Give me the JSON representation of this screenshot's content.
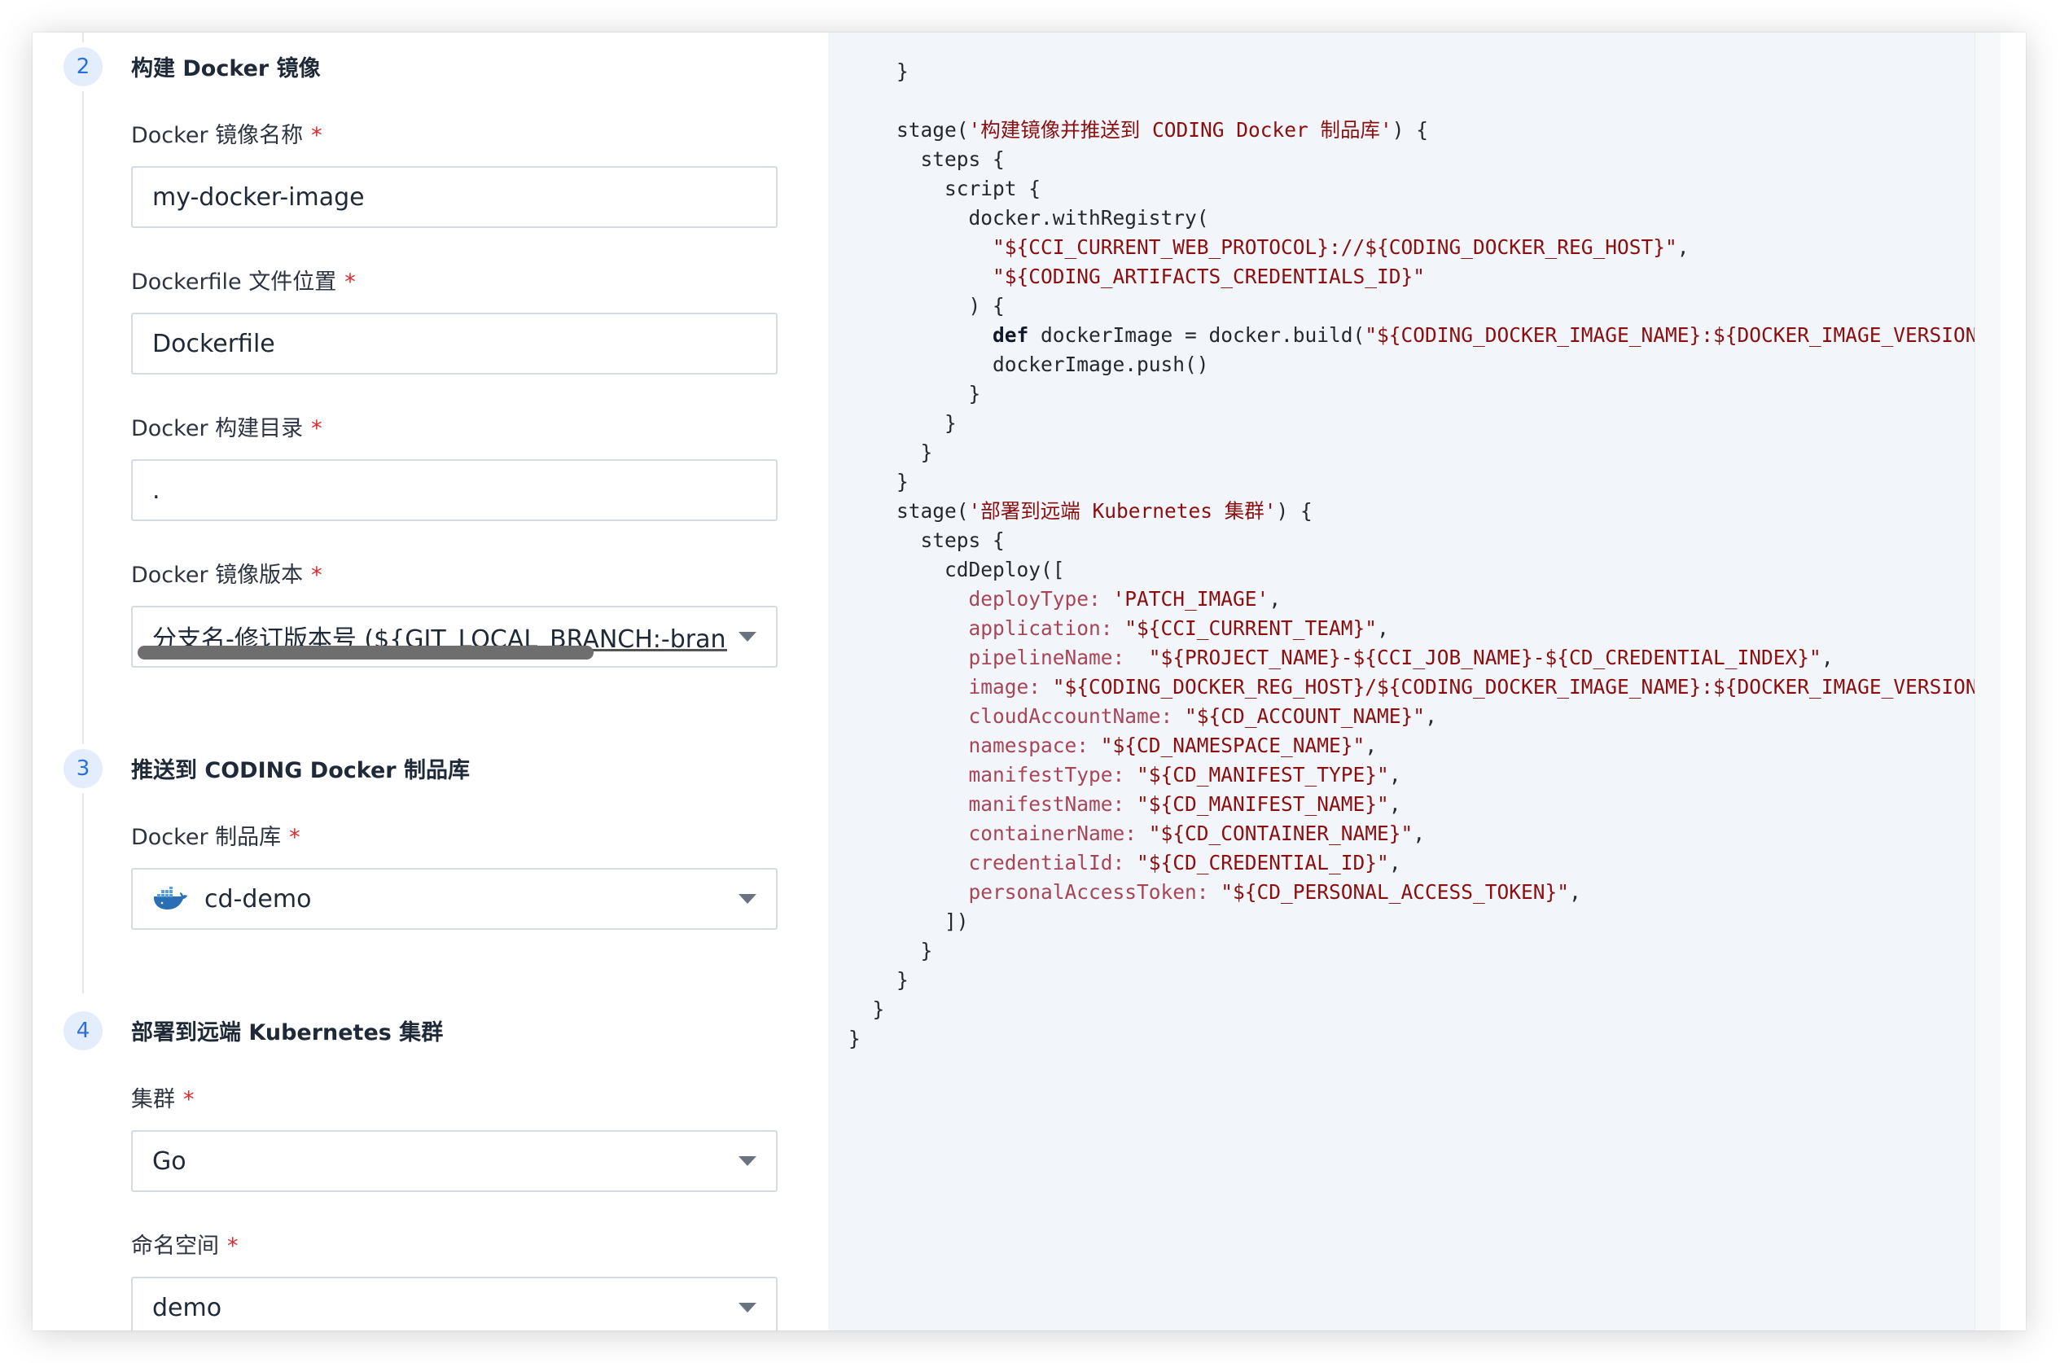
{
  "form": {
    "steps": [
      {
        "number": "2",
        "title": "构建 Docker 镜像",
        "fields": [
          {
            "label": "Docker 镜像名称",
            "required": "*",
            "type": "input",
            "value": "my-docker-image"
          },
          {
            "label": "Dockerfile 文件位置",
            "required": "*",
            "type": "input",
            "value": "Dockerfile"
          },
          {
            "label": "Docker 构建目录",
            "required": "*",
            "type": "input",
            "value": "."
          },
          {
            "label": "Docker 镜像版本",
            "required": "*",
            "type": "select",
            "value": "分支名-修订版本号 (${GIT_LOCAL_BRANCH:-branch}-$"
          }
        ]
      },
      {
        "number": "3",
        "title": "推送到 CODING Docker 制品库",
        "fields": [
          {
            "label": "Docker 制品库",
            "required": "*",
            "type": "select",
            "icon": "docker-whale-icon",
            "value": "cd-demo"
          }
        ]
      },
      {
        "number": "4",
        "title": "部署到远端 Kubernetes 集群",
        "fields": [
          {
            "label": "集群",
            "required": "*",
            "type": "select",
            "value": "Go"
          },
          {
            "label": "命名空间",
            "required": "*",
            "type": "select",
            "value": "demo"
          }
        ]
      }
    ]
  },
  "code": {
    "lines": [
      [
        [
          "p",
          "    }"
        ]
      ],
      [
        [
          "p",
          ""
        ]
      ],
      [
        [
          "p",
          "    stage("
        ],
        [
          "s",
          "'构建镜像并推送到 CODING Docker 制品库'"
        ],
        [
          "p",
          ") {"
        ]
      ],
      [
        [
          "p",
          "      steps {"
        ]
      ],
      [
        [
          "p",
          "        script {"
        ]
      ],
      [
        [
          "p",
          "          docker.withRegistry("
        ]
      ],
      [
        [
          "p",
          "            "
        ],
        [
          "s",
          "\"${CCI_CURRENT_WEB_PROTOCOL}://${CODING_DOCKER_REG_HOST}\""
        ],
        [
          "p",
          ","
        ]
      ],
      [
        [
          "p",
          "            "
        ],
        [
          "s",
          "\"${CODING_ARTIFACTS_CREDENTIALS_ID}\""
        ]
      ],
      [
        [
          "p",
          "          ) {"
        ]
      ],
      [
        [
          "p",
          "            "
        ],
        [
          "k",
          "def"
        ],
        [
          "p",
          " dockerImage = docker.build("
        ],
        [
          "s",
          "\"${CODING_DOCKER_IMAGE_NAME}:${DOCKER_IMAGE_VERSION}\""
        ],
        [
          "p",
          ","
        ]
      ],
      [
        [
          "p",
          "            dockerImage.push()"
        ]
      ],
      [
        [
          "p",
          "          }"
        ]
      ],
      [
        [
          "p",
          "        }"
        ]
      ],
      [
        [
          "p",
          "      }"
        ]
      ],
      [
        [
          "p",
          "    }"
        ]
      ],
      [
        [
          "p",
          "    stage("
        ],
        [
          "s",
          "'部署到远端 Kubernetes 集群'"
        ],
        [
          "p",
          ") {"
        ]
      ],
      [
        [
          "p",
          "      steps {"
        ]
      ],
      [
        [
          "p",
          "        cdDeploy(["
        ]
      ],
      [
        [
          "p",
          "          "
        ],
        [
          "a",
          "deployType:"
        ],
        [
          "p",
          " "
        ],
        [
          "s",
          "'PATCH_IMAGE'"
        ],
        [
          "p",
          ","
        ]
      ],
      [
        [
          "p",
          "          "
        ],
        [
          "a",
          "application:"
        ],
        [
          "p",
          " "
        ],
        [
          "s",
          "\"${CCI_CURRENT_TEAM}\""
        ],
        [
          "p",
          ","
        ]
      ],
      [
        [
          "p",
          "          "
        ],
        [
          "a",
          "pipelineName:"
        ],
        [
          "p",
          "  "
        ],
        [
          "s",
          "\"${PROJECT_NAME}-${CCI_JOB_NAME}-${CD_CREDENTIAL_INDEX}\""
        ],
        [
          "p",
          ","
        ]
      ],
      [
        [
          "p",
          "          "
        ],
        [
          "a",
          "image:"
        ],
        [
          "p",
          " "
        ],
        [
          "s",
          "\"${CODING_DOCKER_REG_HOST}/${CODING_DOCKER_IMAGE_NAME}:${DOCKER_IMAGE_VERSION}\""
        ],
        [
          "p",
          ","
        ]
      ],
      [
        [
          "p",
          "          "
        ],
        [
          "a",
          "cloudAccountName:"
        ],
        [
          "p",
          " "
        ],
        [
          "s",
          "\"${CD_ACCOUNT_NAME}\""
        ],
        [
          "p",
          ","
        ]
      ],
      [
        [
          "p",
          "          "
        ],
        [
          "a",
          "namespace:"
        ],
        [
          "p",
          " "
        ],
        [
          "s",
          "\"${CD_NAMESPACE_NAME}\""
        ],
        [
          "p",
          ","
        ]
      ],
      [
        [
          "p",
          "          "
        ],
        [
          "a",
          "manifestType:"
        ],
        [
          "p",
          " "
        ],
        [
          "s",
          "\"${CD_MANIFEST_TYPE}\""
        ],
        [
          "p",
          ","
        ]
      ],
      [
        [
          "p",
          "          "
        ],
        [
          "a",
          "manifestName:"
        ],
        [
          "p",
          " "
        ],
        [
          "s",
          "\"${CD_MANIFEST_NAME}\""
        ],
        [
          "p",
          ","
        ]
      ],
      [
        [
          "p",
          "          "
        ],
        [
          "a",
          "containerName:"
        ],
        [
          "p",
          " "
        ],
        [
          "s",
          "\"${CD_CONTAINER_NAME}\""
        ],
        [
          "p",
          ","
        ]
      ],
      [
        [
          "p",
          "          "
        ],
        [
          "a",
          "credentialId:"
        ],
        [
          "p",
          " "
        ],
        [
          "s",
          "\"${CD_CREDENTIAL_ID}\""
        ],
        [
          "p",
          ","
        ]
      ],
      [
        [
          "p",
          "          "
        ],
        [
          "a",
          "personalAccessToken:"
        ],
        [
          "p",
          " "
        ],
        [
          "s",
          "\"${CD_PERSONAL_ACCESS_TOKEN}\""
        ],
        [
          "p",
          ","
        ]
      ],
      [
        [
          "p",
          "        ])"
        ]
      ],
      [
        [
          "p",
          "      }"
        ]
      ],
      [
        [
          "p",
          "    }"
        ]
      ],
      [
        [
          "p",
          "  }"
        ]
      ],
      [
        [
          "p",
          "}"
        ]
      ]
    ]
  }
}
